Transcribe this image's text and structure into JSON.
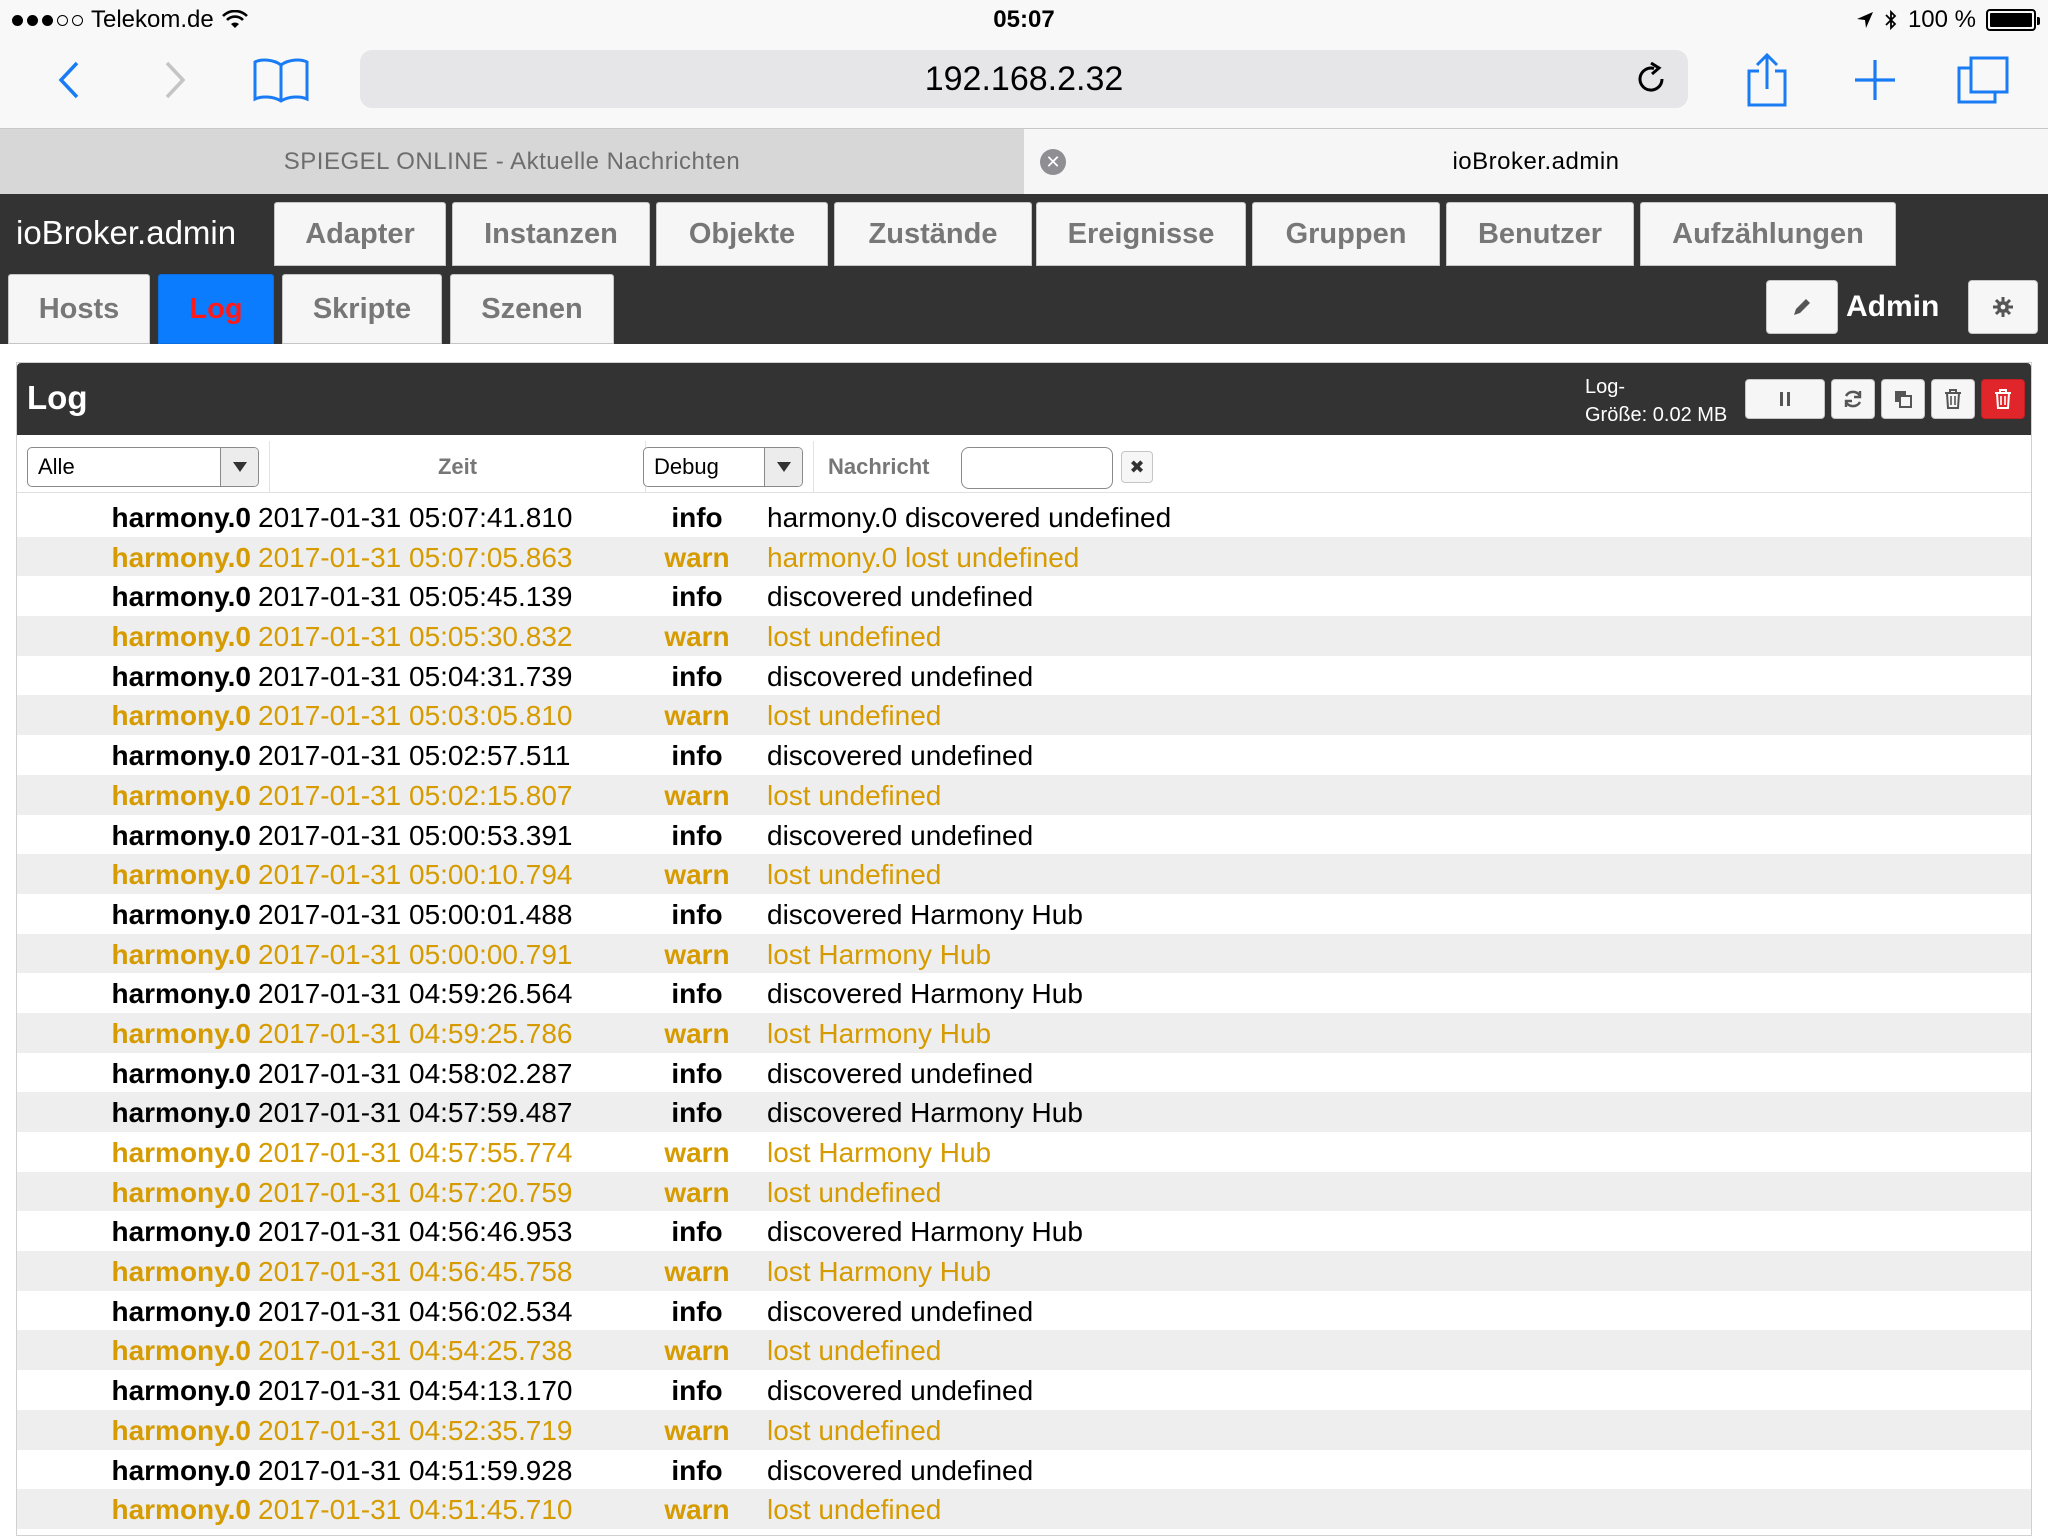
{
  "status_bar": {
    "carrier": "Telekom.de",
    "time": "05:07",
    "battery": "100 %"
  },
  "browser": {
    "url": "192.168.2.32",
    "tabs": [
      {
        "label": "SPIEGEL ONLINE - Aktuelle Nachrichten",
        "active": false
      },
      {
        "label": "ioBroker.admin",
        "active": true
      }
    ]
  },
  "app": {
    "brand": "ioBroker.admin",
    "nav_top": [
      "Adapter",
      "Instanzen",
      "Objekte",
      "Zustände",
      "Ereignisse",
      "Gruppen",
      "Benutzer",
      "Aufzählungen"
    ],
    "nav_bottom": [
      "Hosts",
      "Log",
      "Skripte",
      "Szenen"
    ],
    "active_tab": "Log",
    "user": "Admin"
  },
  "log": {
    "title": "Log",
    "size_label_line1": "Log-",
    "size_label_line2": "Größe: 0.02 MB",
    "filters": {
      "source": "Alle",
      "time_header": "Zeit",
      "severity": "Debug",
      "message_header": "Nachricht",
      "message_value": ""
    },
    "rows": [
      {
        "from": "harmony.0",
        "time": "2017-01-31 05:07:41.810",
        "severity": "info",
        "message": "harmony.0 discovered undefined"
      },
      {
        "from": "harmony.0",
        "time": "2017-01-31 05:07:05.863",
        "severity": "warn",
        "message": "harmony.0 lost undefined"
      },
      {
        "from": "harmony.0",
        "time": "2017-01-31 05:05:45.139",
        "severity": "info",
        "message": "discovered undefined"
      },
      {
        "from": "harmony.0",
        "time": "2017-01-31 05:05:30.832",
        "severity": "warn",
        "message": "lost undefined"
      },
      {
        "from": "harmony.0",
        "time": "2017-01-31 05:04:31.739",
        "severity": "info",
        "message": "discovered undefined"
      },
      {
        "from": "harmony.0",
        "time": "2017-01-31 05:03:05.810",
        "severity": "warn",
        "message": "lost undefined"
      },
      {
        "from": "harmony.0",
        "time": "2017-01-31 05:02:57.511",
        "severity": "info",
        "message": "discovered undefined"
      },
      {
        "from": "harmony.0",
        "time": "2017-01-31 05:02:15.807",
        "severity": "warn",
        "message": "lost undefined"
      },
      {
        "from": "harmony.0",
        "time": "2017-01-31 05:00:53.391",
        "severity": "info",
        "message": "discovered undefined"
      },
      {
        "from": "harmony.0",
        "time": "2017-01-31 05:00:10.794",
        "severity": "warn",
        "message": "lost undefined"
      },
      {
        "from": "harmony.0",
        "time": "2017-01-31 05:00:01.488",
        "severity": "info",
        "message": "discovered Harmony Hub"
      },
      {
        "from": "harmony.0",
        "time": "2017-01-31 05:00:00.791",
        "severity": "warn",
        "message": "lost Harmony Hub"
      },
      {
        "from": "harmony.0",
        "time": "2017-01-31 04:59:26.564",
        "severity": "info",
        "message": "discovered Harmony Hub"
      },
      {
        "from": "harmony.0",
        "time": "2017-01-31 04:59:25.786",
        "severity": "warn",
        "message": "lost Harmony Hub"
      },
      {
        "from": "harmony.0",
        "time": "2017-01-31 04:58:02.287",
        "severity": "info",
        "message": "discovered undefined"
      },
      {
        "from": "harmony.0",
        "time": "2017-01-31 04:57:59.487",
        "severity": "info",
        "message": "discovered Harmony Hub"
      },
      {
        "from": "harmony.0",
        "time": "2017-01-31 04:57:55.774",
        "severity": "warn",
        "message": "lost Harmony Hub"
      },
      {
        "from": "harmony.0",
        "time": "2017-01-31 04:57:20.759",
        "severity": "warn",
        "message": "lost undefined"
      },
      {
        "from": "harmony.0",
        "time": "2017-01-31 04:56:46.953",
        "severity": "info",
        "message": "discovered Harmony Hub"
      },
      {
        "from": "harmony.0",
        "time": "2017-01-31 04:56:45.758",
        "severity": "warn",
        "message": "lost Harmony Hub"
      },
      {
        "from": "harmony.0",
        "time": "2017-01-31 04:56:02.534",
        "severity": "info",
        "message": "discovered undefined"
      },
      {
        "from": "harmony.0",
        "time": "2017-01-31 04:54:25.738",
        "severity": "warn",
        "message": "lost undefined"
      },
      {
        "from": "harmony.0",
        "time": "2017-01-31 04:54:13.170",
        "severity": "info",
        "message": "discovered undefined"
      },
      {
        "from": "harmony.0",
        "time": "2017-01-31 04:52:35.719",
        "severity": "warn",
        "message": "lost undefined"
      },
      {
        "from": "harmony.0",
        "time": "2017-01-31 04:51:59.928",
        "severity": "info",
        "message": "discovered undefined"
      },
      {
        "from": "harmony.0",
        "time": "2017-01-31 04:51:45.710",
        "severity": "warn",
        "message": "lost undefined"
      }
    ]
  },
  "colors": {
    "header_bg": "#333333",
    "active_tab_bg": "#0c7cff",
    "active_tab_text": "#ff1a1a",
    "warn_text": "#d69b00",
    "ios_blue": "#1a7cf5",
    "danger": "#e0262b"
  },
  "icons": {
    "toolbar": [
      "back-chevron-icon",
      "forward-chevron-icon",
      "bookmarks-icon",
      "reload-icon",
      "share-icon",
      "new-tab-icon",
      "tabs-icon"
    ],
    "log_tools": [
      "pause-icon",
      "refresh-icon",
      "copy-icon",
      "trash-icon",
      "trash-all-icon"
    ]
  }
}
